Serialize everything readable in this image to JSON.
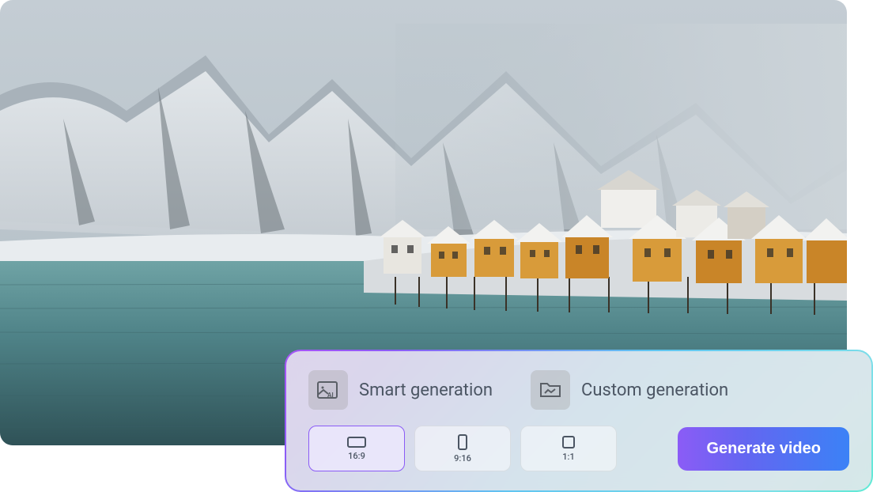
{
  "hero": {
    "description": "Snowy Nordic coastal village with mountains and teal water"
  },
  "panel": {
    "smart": {
      "label": "Smart generation",
      "icon": "image-ai-icon"
    },
    "custom": {
      "label": "Custom generation",
      "icon": "folder-image-icon"
    },
    "ratios": [
      {
        "id": "16-9",
        "label": "16:9",
        "active": true
      },
      {
        "id": "9-16",
        "label": "9:16",
        "active": false
      },
      {
        "id": "1-1",
        "label": "1:1",
        "active": false
      }
    ],
    "generate_label": "Generate video",
    "colors": {
      "gradient_start": "#8b5cf6",
      "gradient_end": "#3b82f6",
      "border_gradient_start": "#a855f7",
      "border_gradient_end": "#5eead4"
    }
  }
}
